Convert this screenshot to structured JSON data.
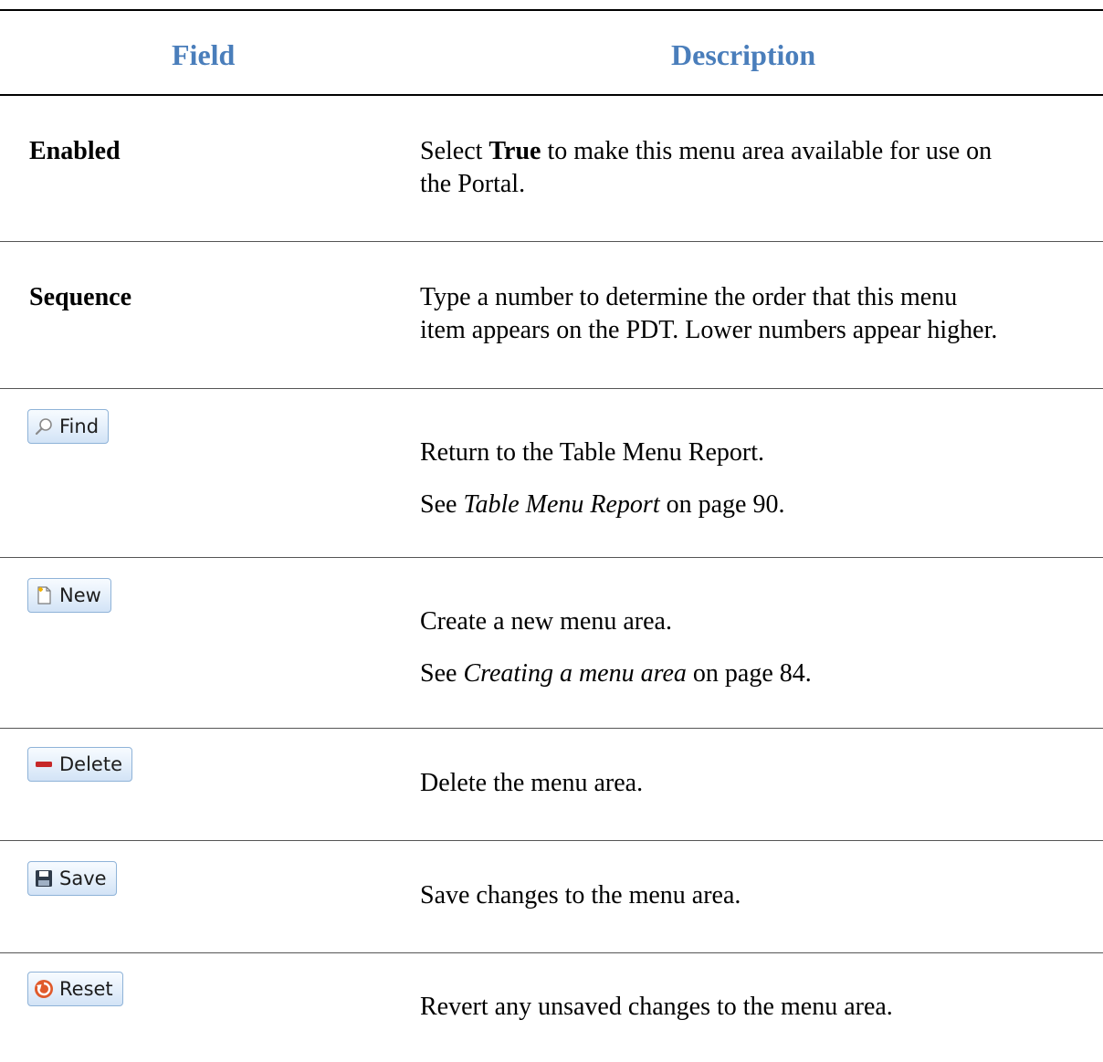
{
  "table": {
    "headers": {
      "field": "Field",
      "description": "Description"
    },
    "rows": {
      "enabled": {
        "field": "Enabled",
        "desc_pre": "Select ",
        "desc_bold": "True",
        "desc_post_line1": " to make this menu area available for use on",
        "desc_line2": "the Portal."
      },
      "sequence": {
        "field": "Sequence",
        "desc_line1": "Type a number to determine the order that this menu",
        "desc_line2": "item appears on the PDT. Lower numbers appear higher."
      },
      "find": {
        "button_label": "Find",
        "icon": "search-icon",
        "desc": "Return to the Table Menu Report.",
        "see_pre": "See ",
        "see_ref": "Table Menu Report",
        "see_post": " on page 90."
      },
      "new": {
        "button_label": "New",
        "icon": "new-document-icon",
        "desc": "Create a new menu area.",
        "see_pre": "See ",
        "see_ref": "Creating a menu area",
        "see_post": " on page 84."
      },
      "delete": {
        "button_label": "Delete",
        "icon": "minus-icon",
        "desc": "Delete the menu area."
      },
      "save": {
        "button_label": "Save",
        "icon": "floppy-disk-icon",
        "desc": "Save changes to the menu area."
      },
      "reset": {
        "button_label": "Reset",
        "icon": "reset-icon",
        "desc": "Revert any unsaved changes to the menu area."
      }
    }
  },
  "colors": {
    "header_text": "#4a7ebb",
    "button_border": "#8fb3d8",
    "delete_icon": "#c62828",
    "reset_icon": "#e05a2b"
  }
}
